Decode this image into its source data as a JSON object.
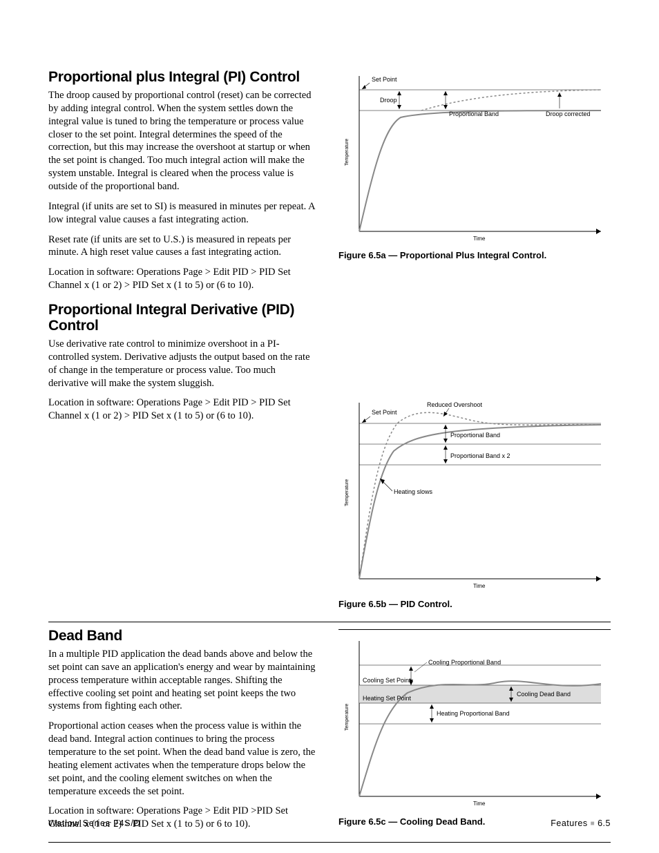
{
  "s1": {
    "heading": "Proportional plus Integral (PI) Control",
    "p1": "The droop caused by proportional control (reset) can be corrected by adding integral control. When the system settles down the integral value is tuned to bring the temperature or process value closer to the set point. Integral determines the speed of the correction, but this may increase the overshoot at startup or when the set point is changed. Too much integral action will make the system unstable. Integral is cleared when the process value is outside of the proportional band.",
    "p2": "Integral (if units are set to SI) is measured in minutes per repeat. A low integral value causes a fast integrating action.",
    "p3": "Reset rate (if units are set to U.S.) is measured in repeats per minute. A high reset value causes a fast integrating action.",
    "p4": "Location in software: Operations Page > Edit PID > PID Set Channel x (1 or 2) > PID Set x (1 to 5) or (6 to 10)."
  },
  "s2": {
    "heading": "Proportional Integral Derivative (PID) Control",
    "p1": "Use derivative rate control to minimize overshoot in a PI-controlled system. Derivative adjusts the output based on the rate of change in the temperature or process value. Too much derivative will make the system sluggish.",
    "p2": "Location in software: Operations Page > Edit PID > PID Set Channel x (1 or 2) > PID Set x (1 to 5) or (6 to 10)."
  },
  "s3": {
    "heading": "Dead Band",
    "p1": "In a multiple PID application the dead bands above and below the set point can save an application's energy and wear by maintaining process temperature within acceptable ranges. Shifting the effective cooling set point and heating set point keeps the two systems from fighting each other.",
    "p2": "Proportional action ceases when the process value is within the dead band. Integral action continues to bring the process temperature to the set point. When the dead band value is zero, the heating element activates when the temperature drops below the set point, and the cooling element switches on when the temperature exceeds the set point.",
    "p3": "Location in software: Operations Page > Edit PID >PID Set Channel x (1 or 2) > PID Set x (1 to 5) or 6 to 10)."
  },
  "figures": {
    "a": {
      "caption": "Figure 6.5a — Proportional Plus Integral Control.",
      "labels": {
        "setpoint": "Set Point",
        "droop": "Droop",
        "propband": "Proportional Band",
        "droopcorr": "Droop corrected",
        "xaxis": "Time",
        "yaxis": "Temperature"
      }
    },
    "b": {
      "caption": "Figure 6.5b — PID Control.",
      "labels": {
        "setpoint": "Set Point",
        "reduced": "Reduced Overshoot",
        "propband": "Proportional Band",
        "propband2": "Proportional Band x 2",
        "heatslow": "Heating slows",
        "xaxis": "Time",
        "yaxis": "Temperature"
      }
    },
    "c": {
      "caption": "Figure 6.5c — Cooling Dead Band.",
      "labels": {
        "coolprop": "Cooling Proportional Band",
        "coolsp": "Cooling Set Point",
        "cooldb": "Cooling Dead Band",
        "heatsp": "Heating Set Point",
        "heatprop": "Heating Proportional Band",
        "xaxis": "Time",
        "yaxis": "Temperature"
      }
    }
  },
  "footer": {
    "left": "Watlow Series F4S/D",
    "right_label": "Features",
    "right_page": "6.5"
  }
}
